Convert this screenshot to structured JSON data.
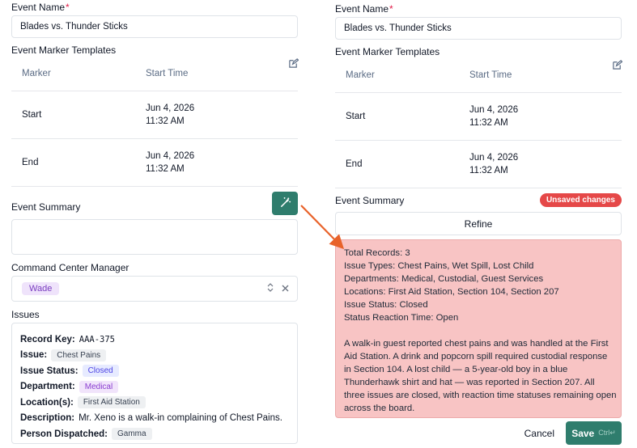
{
  "left": {
    "event_name": {
      "label": "Event Name",
      "required_mark": "*",
      "value": "Blades vs. Thunder Sticks"
    },
    "templates": {
      "label": "Event Marker Templates",
      "columns": [
        "Marker",
        "Start Time"
      ],
      "rows": [
        {
          "marker": "Start",
          "date": "Jun 4, 2026",
          "time": "11:32 AM"
        },
        {
          "marker": "End",
          "date": "Jun 4, 2026",
          "time": "11:32 AM"
        }
      ]
    },
    "summary": {
      "label": "Event Summary",
      "value": ""
    },
    "manager": {
      "label": "Command Center Manager",
      "selected": "Wade"
    },
    "issues": {
      "label": "Issues",
      "record_key_label": "Record Key:",
      "record_key": "AAA-375",
      "issue_label": "Issue:",
      "issue": "Chest Pains",
      "status_label": "Issue Status:",
      "status": "Closed",
      "department_label": "Department:",
      "department": "Medical",
      "location_label": "Location(s):",
      "location": "First Aid Station",
      "description_label": "Description:",
      "description": "Mr. Xeno is a walk-in complaining of Chest Pains.",
      "dispatched_label": "Person Dispatched:",
      "dispatched": "Gamma"
    }
  },
  "right": {
    "event_name": {
      "label": "Event Name",
      "required_mark": "*",
      "value": "Blades vs. Thunder Sticks"
    },
    "templates": {
      "label": "Event Marker Templates",
      "columns": [
        "Marker",
        "Start Time"
      ],
      "rows": [
        {
          "marker": "Start",
          "date": "Jun 4, 2026",
          "time": "11:32 AM"
        },
        {
          "marker": "End",
          "date": "Jun 4, 2026",
          "time": "11:32 AM"
        }
      ]
    },
    "summary": {
      "label": "Event Summary",
      "badge": "Unsaved changes",
      "refine_label": "Refine",
      "lines": [
        "Total Records: 3",
        "Issue Types: Chest Pains, Wet Spill, Lost Child",
        "Departments: Medical, Custodial, Guest Services",
        "Locations: First Aid Station, Section 104, Section 207",
        "Issue Status: Closed",
        "Status Reaction Time: Open"
      ],
      "paragraph_lines": [
        "A walk-in guest reported chest pains and was handled at the First",
        "Aid Station. A drink and popcorn spill required custodial response",
        "in Section 104. A lost child — a 5-year-old boy in a blue",
        "Thunderhawk shirt and hat — was reported in Section 207. All",
        "three issues are closed, with reaction time statuses remaining open",
        "across the board."
      ]
    },
    "footer": {
      "cancel_label": "Cancel",
      "save_label": "Save",
      "shortcut": "Ctrl↵"
    }
  },
  "colors": {
    "accent": "#2f7d6d",
    "unsaved": "#e54848",
    "ai_highlight": "#f8c4c4",
    "arrow": "#e8622a"
  },
  "icons": [
    "edit-icon",
    "magic-wand-icon",
    "chevron-updown-icon",
    "close-icon",
    "arrow-annotation"
  ]
}
